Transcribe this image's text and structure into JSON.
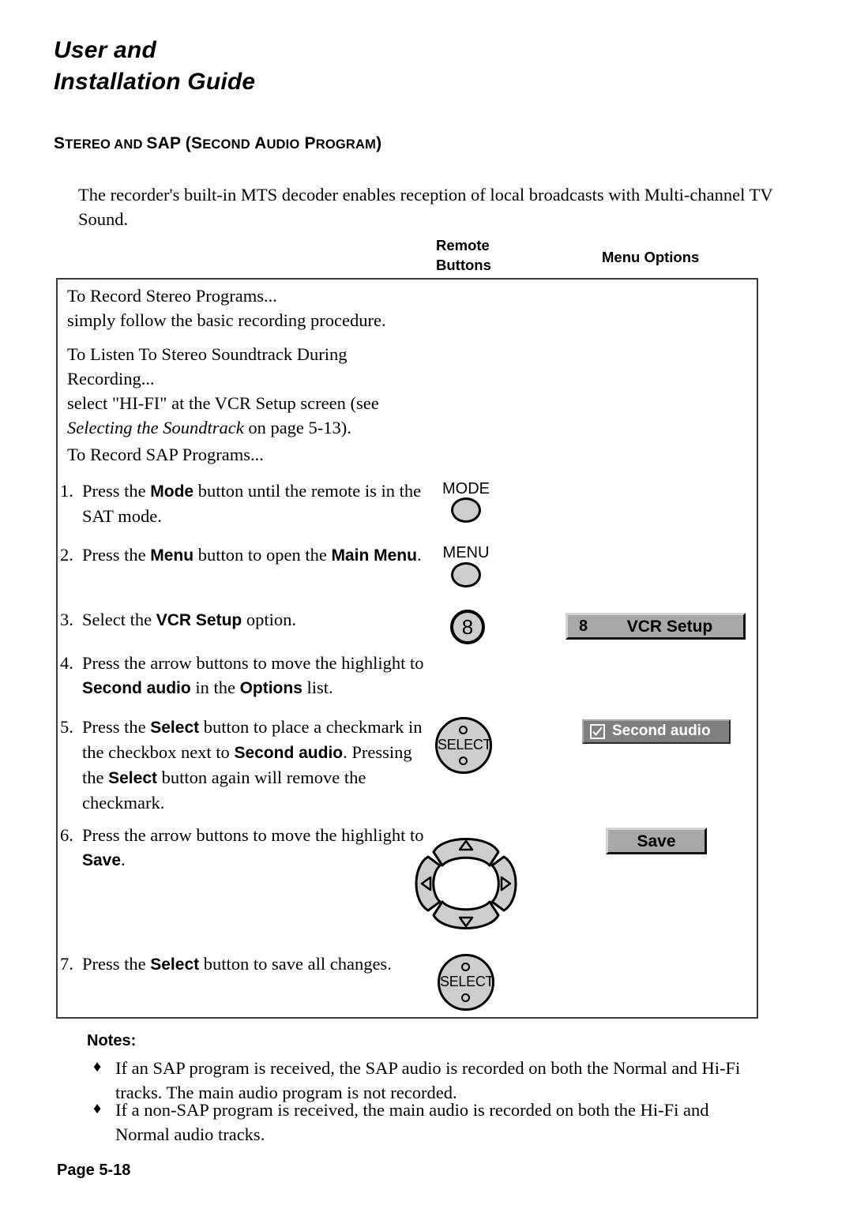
{
  "header": {
    "title_line1": "User and",
    "title_line2": "Installation Guide"
  },
  "section": {
    "heading_parts": [
      {
        "text": "S",
        "small_caps": false
      },
      {
        "text": "TEREO",
        "small_caps": true
      },
      {
        "text": " AND ",
        "small_caps": true
      },
      {
        "text": "SAP (S",
        "small_caps": false
      },
      {
        "text": "ECOND",
        "small_caps": true
      },
      {
        "text": " A",
        "small_caps": false
      },
      {
        "text": "UDIO",
        "small_caps": true
      },
      {
        "text": " P",
        "small_caps": false
      },
      {
        "text": "ROGRAM",
        "small_caps": true
      },
      {
        "text": ")",
        "small_caps": false
      }
    ],
    "heading_plain": "STEREO AND SAP (SECOND AUDIO PROGRAM)"
  },
  "intro": {
    "paragraph": "The recorder's built-in MTS decoder enables reception of local broadcasts with Multi-channel TV Sound."
  },
  "column_labels": {
    "remote_buttons_line1": "Remote",
    "remote_buttons_line2": "Buttons",
    "menu_options": "Menu Options"
  },
  "procedure": {
    "intro_paragraphs": [
      {
        "id": "stereo",
        "lines": [
          "To Record Stereo Programs...",
          "simply follow the basic recording procedure."
        ]
      },
      {
        "id": "listen",
        "lines": [
          "To Listen To Stereo Soundtrack During",
          "Recording...",
          "select \"HI-FI\" at the VCR Setup screen (see"
        ],
        "italic_ref": "Selecting the Soundtrack",
        "after_italic": " on  page  5-13)."
      },
      {
        "id": "sap",
        "lines": [
          "To Record SAP Programs..."
        ]
      }
    ],
    "steps": [
      {
        "number": "1.",
        "segments": [
          {
            "t": "Press the ",
            "b": false
          },
          {
            "t": "Mode",
            "b": true
          },
          {
            "t": " button until the remote is in the SAT mode.",
            "b": false
          }
        ]
      },
      {
        "number": "2.",
        "segments": [
          {
            "t": "Press the ",
            "b": false
          },
          {
            "t": "Menu",
            "b": true
          },
          {
            "t": " button to open the ",
            "b": false
          },
          {
            "t": "Main Menu",
            "b": true
          },
          {
            "t": ".",
            "b": false
          }
        ]
      },
      {
        "number": "3.",
        "segments": [
          {
            "t": "Select the ",
            "b": false
          },
          {
            "t": "VCR Setup",
            "b": true
          },
          {
            "t": " option.",
            "b": false
          }
        ]
      },
      {
        "number": "4.",
        "segments": [
          {
            "t": "Press the arrow buttons to move the highlight to ",
            "b": false
          },
          {
            "t": "Second audio",
            "b": true
          },
          {
            "t": " in the ",
            "b": false
          },
          {
            "t": "Options",
            "b": true
          },
          {
            "t": " list.",
            "b": false
          }
        ]
      },
      {
        "number": "5.",
        "segments": [
          {
            "t": "Press the ",
            "b": false
          },
          {
            "t": "Select",
            "b": true
          },
          {
            "t": " button to place a checkmark in the checkbox next to ",
            "b": false
          },
          {
            "t": "Second audio",
            "b": true
          },
          {
            "t": ".  Pressing the ",
            "b": false
          },
          {
            "t": "Select",
            "b": true
          },
          {
            "t": " button again will remove the checkmark.",
            "b": false
          }
        ]
      },
      {
        "number": "6.",
        "segments": [
          {
            "t": "Press the arrow buttons to move the highlight to ",
            "b": false
          },
          {
            "t": "Save",
            "b": true
          },
          {
            "t": ".",
            "b": false
          }
        ]
      },
      {
        "number": "7.",
        "segments": [
          {
            "t": "Press the ",
            "b": false
          },
          {
            "t": "Select",
            "b": true
          },
          {
            "t": " button to save all changes.",
            "b": false
          }
        ]
      }
    ]
  },
  "remote_keys": {
    "mode_label": "MODE",
    "menu_label": "MENU",
    "numeric_key": "8",
    "select_label_1": "SELECT",
    "select_label_2": "SELECT"
  },
  "menu_graphics": {
    "vcr_setup_index": "8",
    "vcr_setup_label": "VCR Setup",
    "second_audio_label": "Second audio",
    "second_audio_checked": true,
    "save_label": "Save"
  },
  "notes": {
    "title": "Notes:",
    "bullet_glyph": "♦",
    "items": [
      "If an SAP program is received, the SAP audio is recorded on both the Normal and Hi-Fi tracks.  The main audio program is not recorded.",
      "If a non-SAP program is received, the main audio is recorded on both the Hi-Fi and Normal audio tracks."
    ]
  },
  "footer": {
    "page": "Page 5-18"
  },
  "colors": {
    "button_face": "#cdcdcd",
    "menu_raised": "#a8a8a8",
    "menu_highlight": "#7f7f7f",
    "box_border": "#3a3a3a",
    "text": "#000000"
  }
}
